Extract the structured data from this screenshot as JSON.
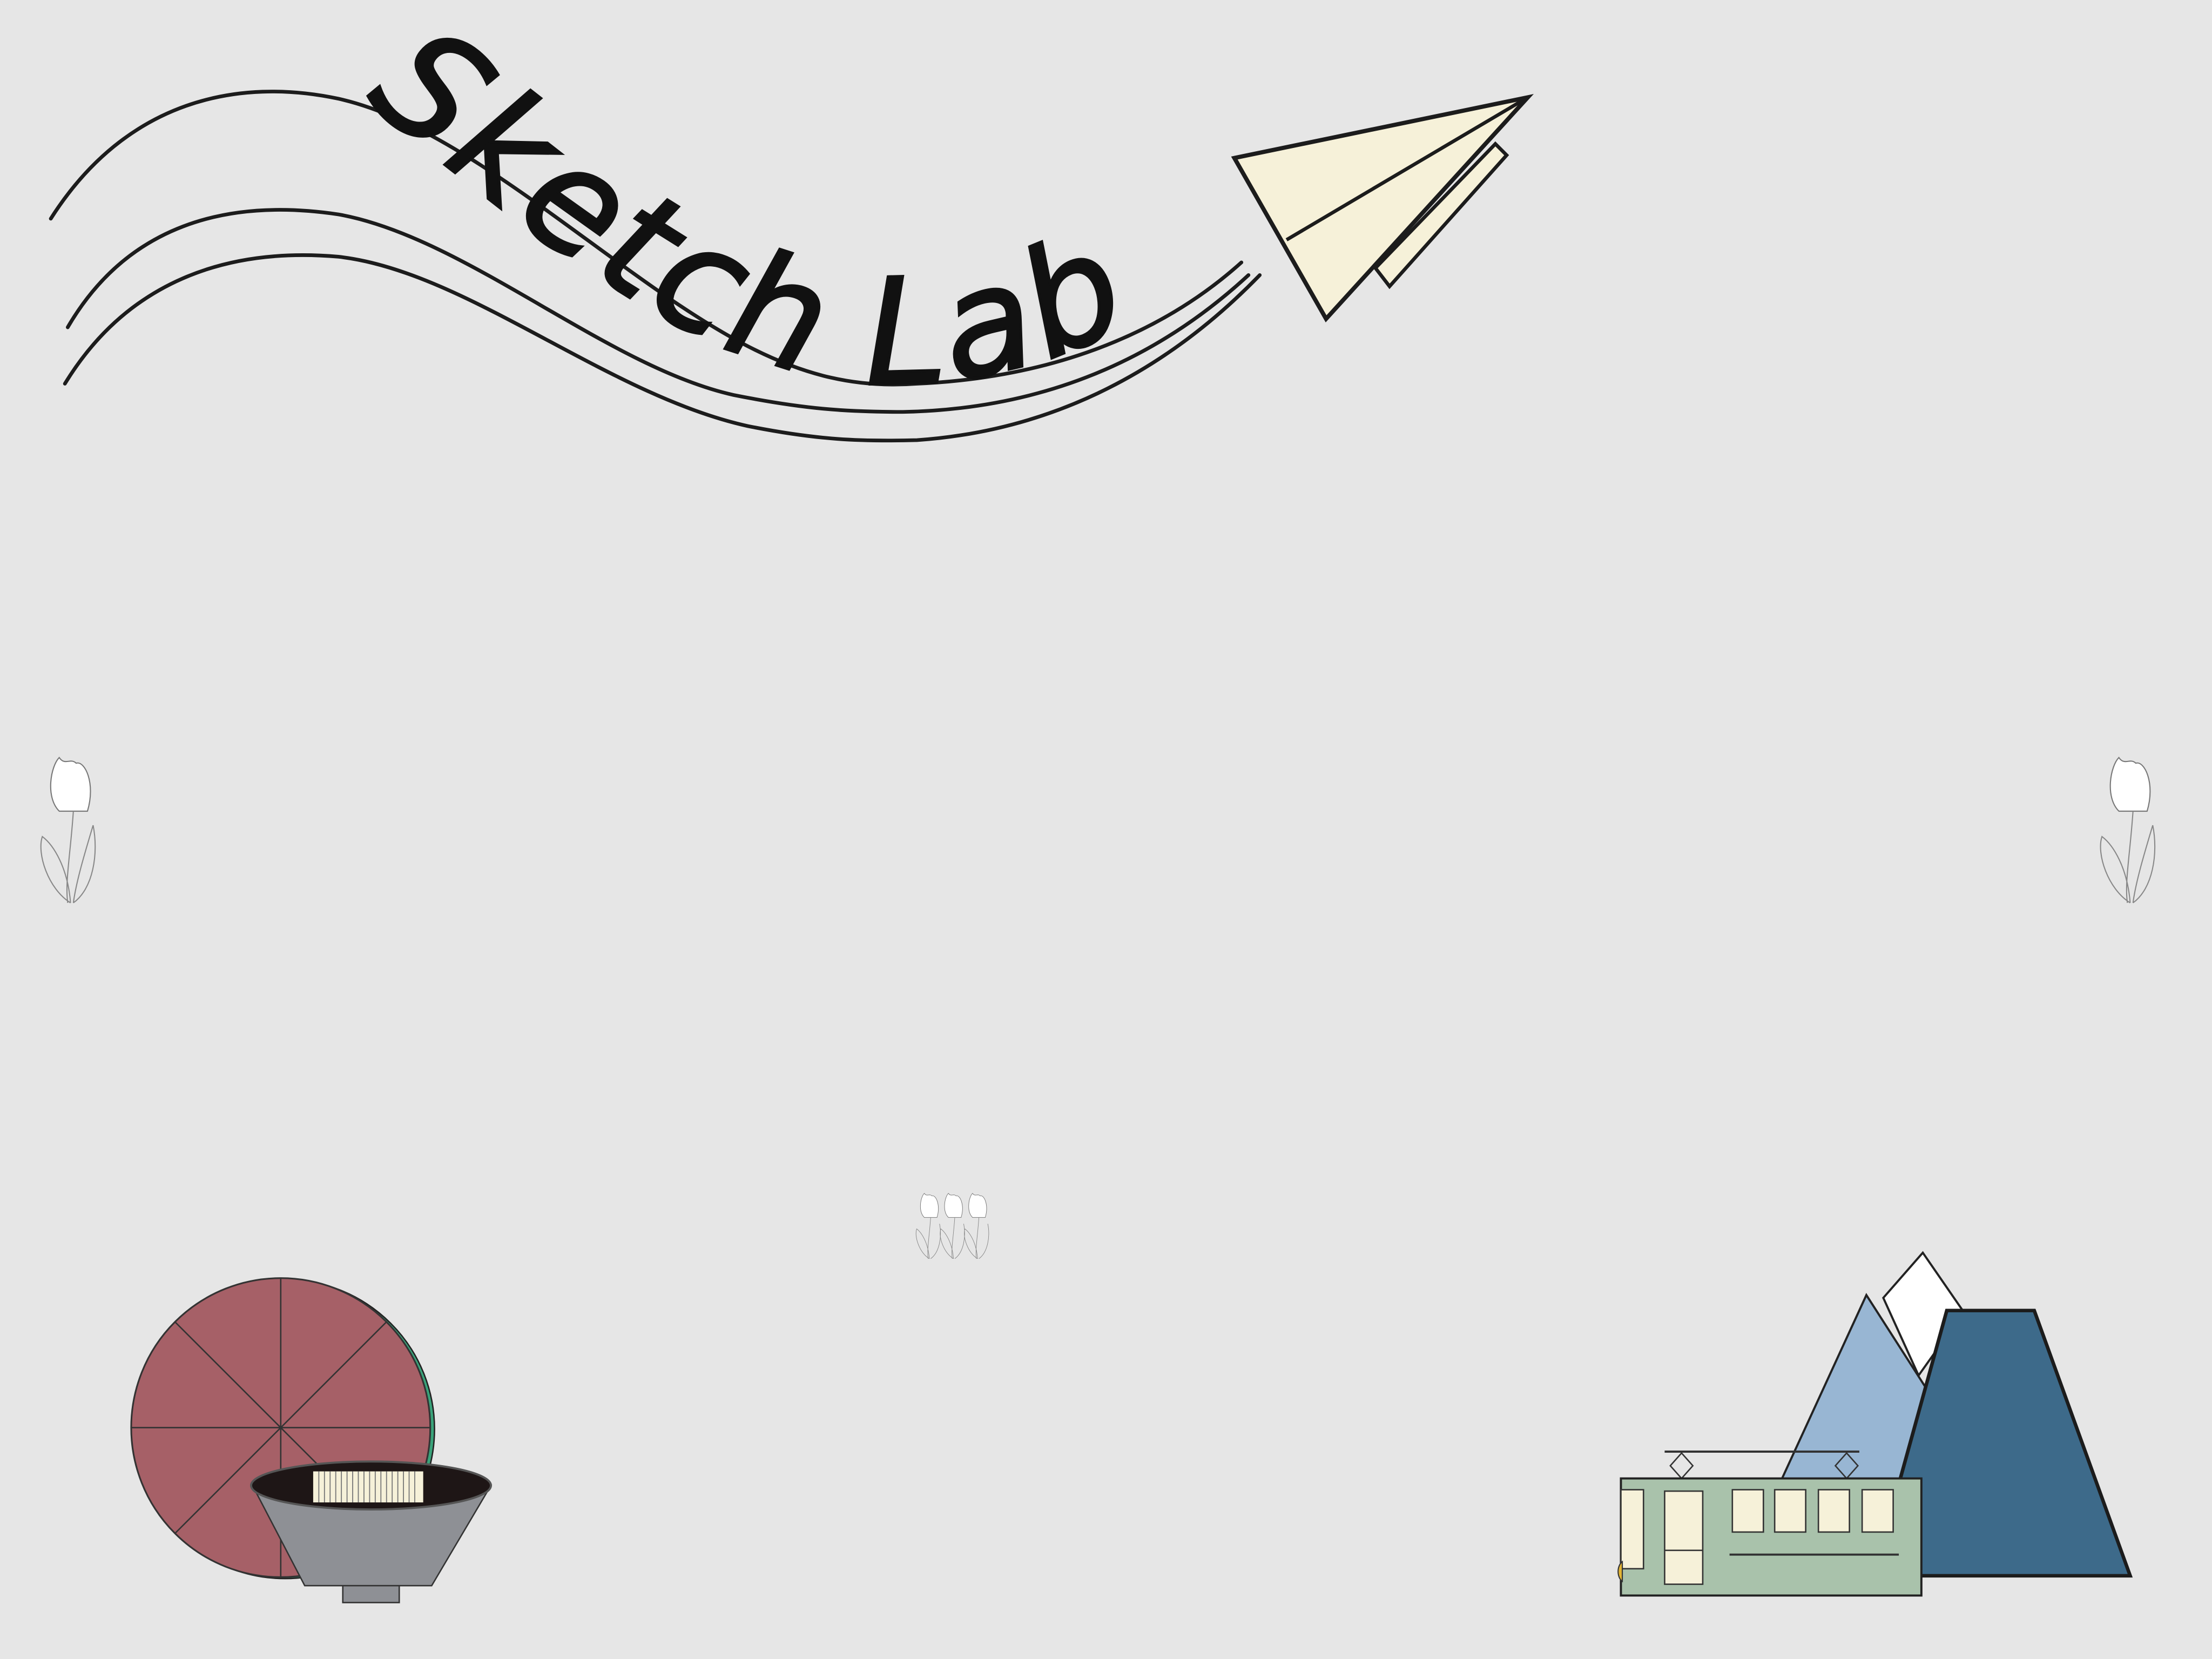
{
  "logo": {
    "title": "Sketch Lab",
    "icon": "paper-plane-icon"
  },
  "decorations": [
    "tulip-icon",
    "tulip-icon",
    "tulip-cluster-icon",
    "pie-icon",
    "bowl-icon",
    "mountains-icon",
    "tram-icon"
  ],
  "colors": {
    "background": "#e6e6e6",
    "plane": "#f6f1d9",
    "pie": "#a66067",
    "pie_edge": "#3aa37a",
    "bowl": "#8e9095",
    "bowl_inside": "#1e1616",
    "mountain_light": "#98b6d3",
    "mountain_dark": "#3d6a8a",
    "tram": "#a9c2ab",
    "window": "#f6f1d9"
  }
}
